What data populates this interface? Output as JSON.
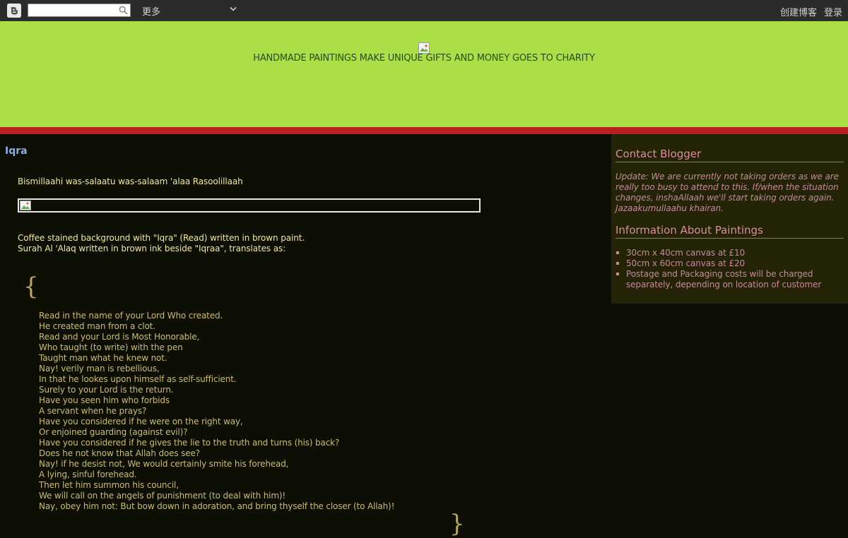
{
  "navbar": {
    "search_value": "",
    "more_label": "更多",
    "create_blog_label": "创建博客",
    "login_label": "登录"
  },
  "header": {
    "description": "HANDMADE PAINTINGS MAKE UNIQUE GIFTS AND MONEY GOES TO CHARITY"
  },
  "post": {
    "title": "Iqra",
    "greeting": "Bismillaahi was-salaatu was-salaam 'alaa Rasoolillaah",
    "caption_line1": "Coffee stained background with \"Iqra\" (Read) written in brown paint.",
    "caption_line2": "Surah Al 'Alaq written in brown ink beside \"Iqraa\", translates as:",
    "brace_open": "{",
    "brace_close": "}",
    "verses": [
      "Read in the name of your Lord Who created.",
      "He created man from a clot.",
      "Read and your Lord is Most Honorable,",
      "Who taught (to write) with the pen",
      "Taught man what he knew not.",
      "Nay! verily man is rebellious,",
      "In that he lookes upon himself as self-sufficient.",
      "Surely to your Lord is the return.",
      "Have you seen him who forbids",
      "A servant when he prays?",
      "Have you considered if he were on the right way,",
      "Or enjoined guarding (against evil)?",
      "Have you considered if he gives the lie to the truth and turns (his) back?",
      "Does he not know that Allah does see?",
      "Nay! if he desist not, We would certainly smite his forehead,",
      "A lying, sinful forehead.",
      "Then let him summon his council,",
      "We will call on the angels of punishment (to deal with him)!",
      "Nay, obey him not: But bow down in adoration, and bring thyself the closer (to Allah)!"
    ]
  },
  "sidebar": {
    "contact_heading": "Contact Blogger",
    "contact_text": "Update: We are currently not taking orders as we are really too busy to attend to this. If/when the situation changes, inshaAllaah we'll start taking orders again. Jazaakumullaahu khairan.",
    "info_heading": "Information About Paintings",
    "info_items": [
      "30cm x 40cm canvas at £10",
      "50cm x 60cm canvas at £20",
      "Postage and Packaging costs will be charged separately, depending on location of customer"
    ]
  },
  "colors": {
    "header_bg": "#abde47",
    "header_border": "#bb2020",
    "page_bg": "#0d0e04",
    "sidebar_bg": "#242305",
    "title_link": "#8caee6",
    "sidebar_text": "#c28a9e"
  },
  "icons": [
    "blogger-logo-icon",
    "search-icon",
    "chevron-down-icon",
    "broken-image-icon"
  ]
}
